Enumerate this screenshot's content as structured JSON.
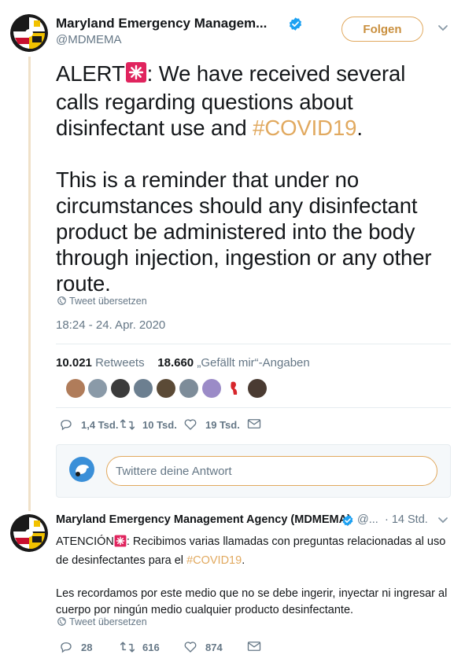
{
  "tweet": {
    "author_name": "Maryland Emergency Managem...",
    "handle": "@MDMEMA",
    "follow_label": "Folgen",
    "text_part1": "ALERT",
    "text_part2": ": We have received several calls regarding questions about disinfectant use and ",
    "hashtag": "#COVID19",
    "text_part3": ".\n\nThis is a reminder that under no circumstances should any disinfectant product be administered into the body through injection, ingestion or any other route.",
    "translate_label": "Tweet übersetzen",
    "timestamp": "18:24 - 24. Apr. 2020",
    "retweets_count": "10.021",
    "retweets_label": "Retweets",
    "likes_count": "18.660",
    "likes_label": "„Gefällt mir“-Angaben",
    "replies": "1,4 Tsd.",
    "retweets_short": "10 Tsd.",
    "likes_short": "19 Tsd."
  },
  "reply_composer": {
    "placeholder": "Twittere deine Antwort"
  },
  "second_tweet": {
    "author_name": "Maryland Emergency Management Agency (MDMEMA)",
    "handle": "@...",
    "time": "· 14 Std.",
    "text_part1": "ATENCIÓN",
    "text_part2": ": Recibimos varias llamadas con preguntas relacionadas al uso de desinfectantes para el ",
    "hashtag": "#COVID19",
    "text_part3": ".\n\nLes recordamos por este medio que no se debe ingerir, inyectar ni ingresar al cuerpo por ningún medio cualquier producto desinfectante.",
    "translate_label": "Tweet übersetzen",
    "replies": "28",
    "retweets": "616",
    "likes": "874"
  },
  "colors": {
    "accent": "#e1a95f",
    "verified": "#1da1f2",
    "muted": "#657786",
    "siren_red": "#e0245e"
  },
  "icons": [
    "verified-badge-icon",
    "chevron-down-icon",
    "siren-emoji-icon",
    "globe-icon",
    "reply-icon",
    "retweet-icon",
    "like-icon",
    "message-icon"
  ]
}
